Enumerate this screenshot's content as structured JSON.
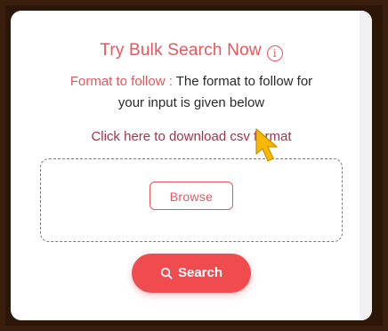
{
  "card": {
    "title": "Try Bulk Search Now",
    "info_icon": "info-icon",
    "format_label": "Format to follow :",
    "format_text_line1": " The format to follow for",
    "format_text_line2": "your input is given below",
    "download_link": "Click here to download csv format",
    "browse_label": "Browse",
    "search_label": "Search",
    "search_icon": "search-icon"
  },
  "colors": {
    "accent": "#e8565b",
    "link": "#a3334c",
    "button_bg": "#f04b4f",
    "frame": "#2b1608",
    "cursor": "#f6b800"
  },
  "cursor": {
    "icon": "pointer-cursor-icon"
  }
}
